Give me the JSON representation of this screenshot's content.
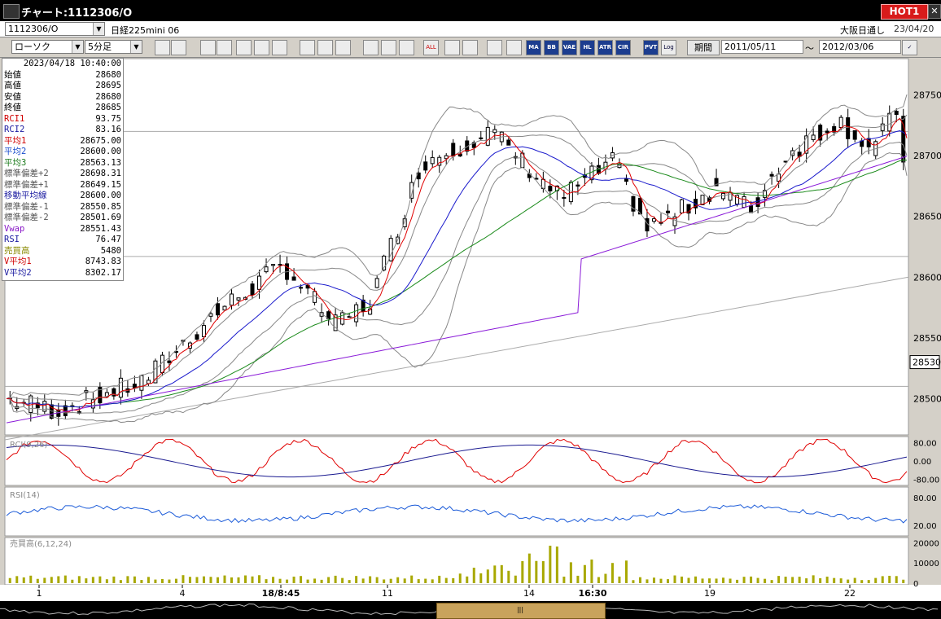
{
  "titlebar": {
    "title": "チャート:1112306/O",
    "hot_label": "HOT1",
    "close_label": "✕"
  },
  "toolbar1": {
    "symbol": "1112306/O",
    "name": "日経225mini 06",
    "session": "大阪日通し",
    "date": "23/04/20"
  },
  "toolbar2": {
    "chart_type": "ローソク",
    "interval": "5分足",
    "buttons": [
      "zoom",
      "cursor",
      "sel",
      "shift",
      "scale",
      "arrange",
      "x",
      "gray",
      "pen",
      "pointer",
      "eraser",
      "bar1",
      "bar2",
      "ALL",
      "cfg",
      "tool",
      "color",
      "table",
      "MA",
      "BB",
      "VAE",
      "HL",
      "ATR",
      "CIR",
      "PVT",
      "Log",
      "save"
    ],
    "period_label": "期間",
    "from_date": "2011/05/11",
    "tilde": "〜",
    "to_date": "2012/03/06"
  },
  "info_panel": [
    {
      "k": "",
      "v": "2023/04/18  10:40:00",
      "c": "#000"
    },
    {
      "k": "始値",
      "v": "28680",
      "c": "#000"
    },
    {
      "k": "高値",
      "v": "28695",
      "c": "#000"
    },
    {
      "k": "安値",
      "v": "28680",
      "c": "#000"
    },
    {
      "k": "終値",
      "v": "28685",
      "c": "#000"
    },
    {
      "k": "RCI1",
      "v": "93.75",
      "c": "#d00000"
    },
    {
      "k": "RCI2",
      "v": "83.16",
      "c": "#1a1aa0"
    },
    {
      "k": "平均1",
      "v": "28675.00",
      "c": "#d00000"
    },
    {
      "k": "平均2",
      "v": "28600.00",
      "c": "#1a4dcc"
    },
    {
      "k": "平均3",
      "v": "28563.13",
      "c": "#1a7a1a"
    },
    {
      "k": "標準偏差+2",
      "v": "28698.31",
      "c": "#555"
    },
    {
      "k": "標準偏差+1",
      "v": "28649.15",
      "c": "#555"
    },
    {
      "k": "移動平均線",
      "v": "28600.00",
      "c": "#1a1aa0"
    },
    {
      "k": "標準偏差-1",
      "v": "28550.85",
      "c": "#555"
    },
    {
      "k": "標準偏差-2",
      "v": "28501.69",
      "c": "#555"
    },
    {
      "k": "Vwap",
      "v": "28551.43",
      "c": "#8a1ac8"
    },
    {
      "k": "RSI",
      "v": "76.47",
      "c": "#1a1aa0"
    },
    {
      "k": "売買高",
      "v": "5480",
      "c": "#8a8a00"
    },
    {
      "k": "V平均1",
      "v": "8743.83",
      "c": "#d00000"
    },
    {
      "k": "V平均2",
      "v": "8302.17",
      "c": "#1a1aa0"
    }
  ],
  "price_axis": [
    "28750",
    "28700",
    "28650",
    "28600",
    "28550",
    "28500"
  ],
  "current_price": "28530",
  "rci": {
    "label": "RCI(9,26)",
    "ticks": [
      "80.00",
      "0.00",
      "-80.00"
    ]
  },
  "rsi": {
    "label": "RSI(14)",
    "ticks": [
      "80.00",
      "20.00"
    ]
  },
  "volume": {
    "label": "売買高(6,12,24)",
    "ticks": [
      "20000",
      "10000",
      "0"
    ]
  },
  "x_axis": [
    {
      "t": "1",
      "bold": false
    },
    {
      "t": "4",
      "bold": false
    },
    {
      "t": "18/8:45",
      "bold": true
    },
    {
      "t": "11",
      "bold": false
    },
    {
      "t": "14",
      "bold": false
    },
    {
      "t": "16:30",
      "bold": true
    },
    {
      "t": "19",
      "bold": false
    },
    {
      "t": "22",
      "bold": false
    }
  ],
  "colors": {
    "ma1": "#e00000",
    "ma2": "#1a1acc",
    "ma3": "#1a8a1a",
    "bb": "#888888",
    "vwap": "#8a1ad8",
    "rsi": "#1a5ad8",
    "vol": "#a8a800"
  }
}
